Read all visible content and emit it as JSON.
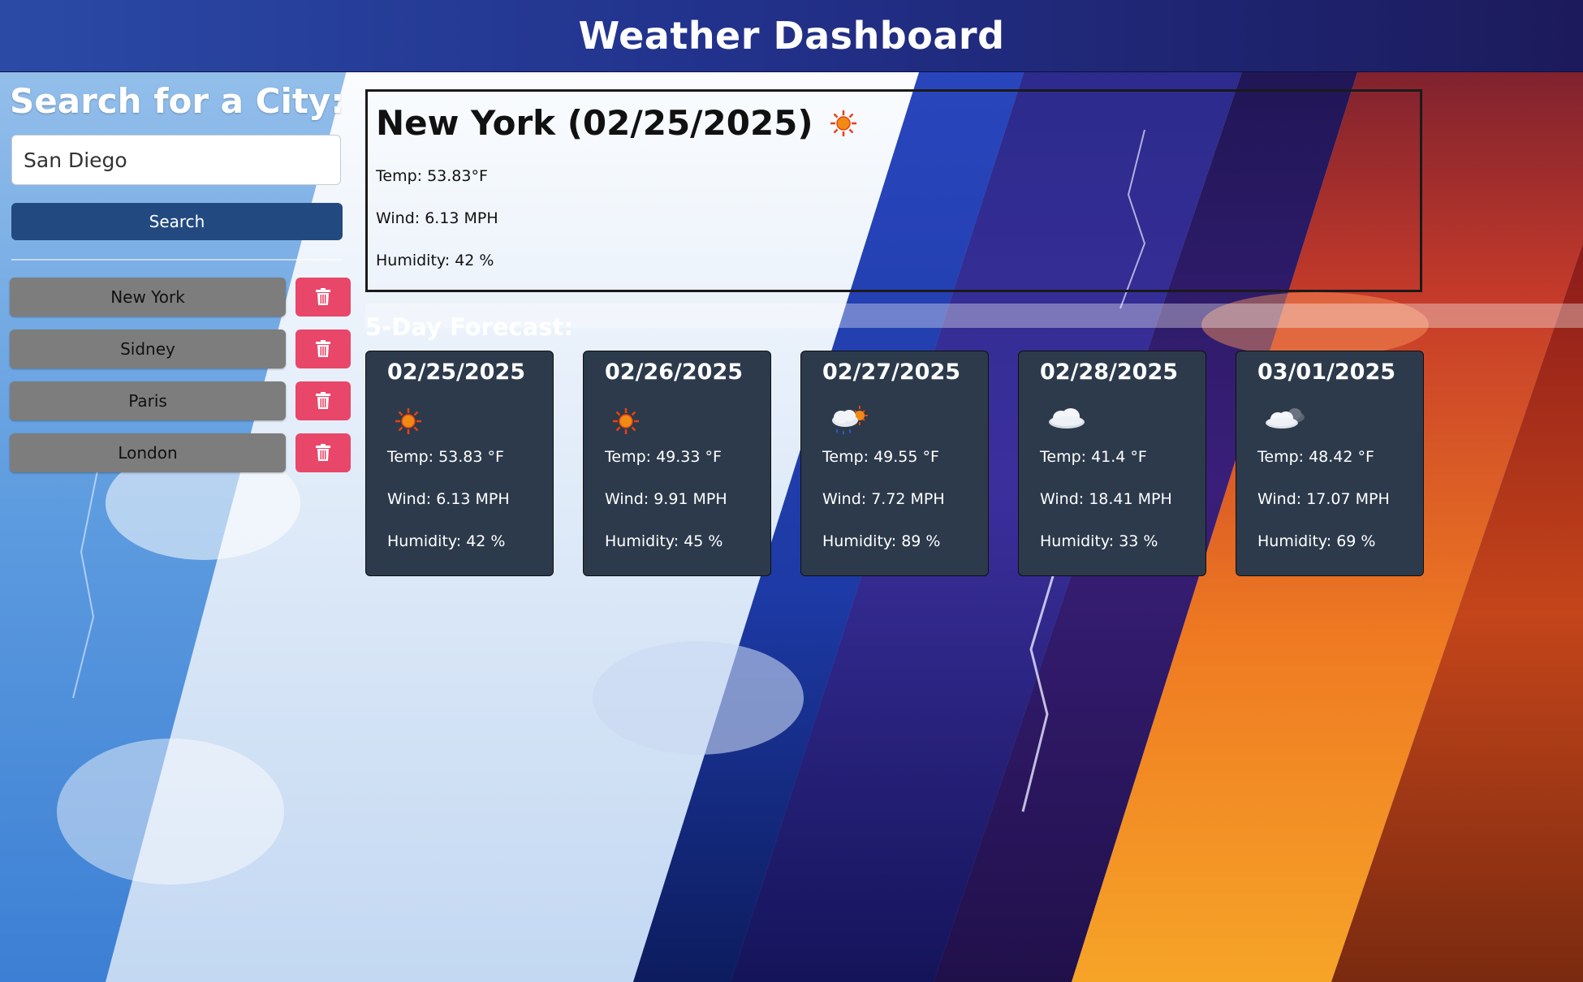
{
  "header": {
    "title": "Weather Dashboard"
  },
  "sidebar": {
    "heading": "Search for a City:",
    "search_value": "San Diego",
    "search_button": "Search",
    "history": [
      {
        "city": "New York",
        "delete_icon": "trash-icon"
      },
      {
        "city": "Sidney",
        "delete_icon": "trash-icon"
      },
      {
        "city": "Paris",
        "delete_icon": "trash-icon"
      },
      {
        "city": "London",
        "delete_icon": "trash-icon"
      }
    ]
  },
  "current": {
    "title": "New York (02/25/2025)",
    "icon": "sun-icon",
    "temp": "Temp: 53.83°F",
    "wind": "Wind: 6.13 MPH",
    "humidity": "Humidity: 42 %"
  },
  "forecast": {
    "heading": "5-Day Forecast:",
    "days": [
      {
        "date": "02/25/2025",
        "icon": "sun-icon",
        "temp": "Temp: 53.83 °F",
        "wind": "Wind: 6.13 MPH",
        "humidity": "Humidity: 42 %"
      },
      {
        "date": "02/26/2025",
        "icon": "sun-icon",
        "temp": "Temp: 49.33 °F",
        "wind": "Wind: 9.91 MPH",
        "humidity": "Humidity: 45 %"
      },
      {
        "date": "02/27/2025",
        "icon": "rain-sun-icon",
        "temp": "Temp: 49.55 °F",
        "wind": "Wind: 7.72 MPH",
        "humidity": "Humidity: 89 %"
      },
      {
        "date": "02/28/2025",
        "icon": "cloud-icon",
        "temp": "Temp: 41.4 °F",
        "wind": "Wind: 18.41 MPH",
        "humidity": "Humidity: 33 %"
      },
      {
        "date": "03/01/2025",
        "icon": "broken-clouds-icon",
        "temp": "Temp: 48.42 °F",
        "wind": "Wind: 17.07 MPH",
        "humidity": "Humidity: 69 %"
      }
    ]
  },
  "colors": {
    "header_start": "#2a4aa6",
    "header_end": "#1c1a5c",
    "search_button": "#234a80",
    "city_button": "#7d7d7d",
    "delete_button": "#e8476a",
    "card_bg": "#2c3a4c"
  }
}
